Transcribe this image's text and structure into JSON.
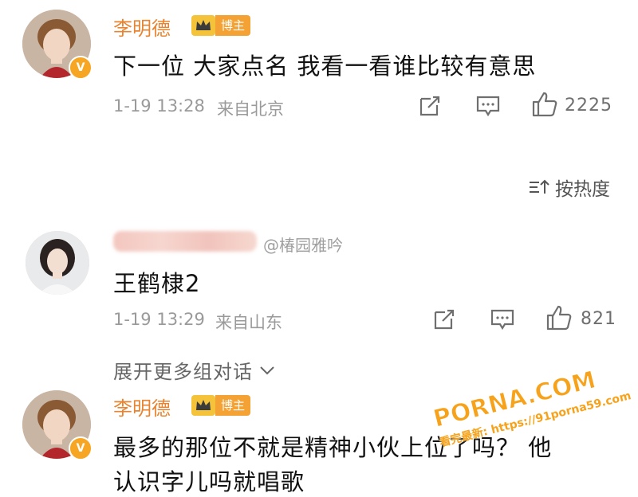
{
  "comments": [
    {
      "username": "李明德",
      "role_badge": "博主",
      "verified_mark": "V",
      "content": "下一位 大家点名 我看一看谁比较有意思",
      "time": "1-19 13:28",
      "location": "来自北京",
      "likes": "2225"
    },
    {
      "username": "",
      "content": "王鹤棣2",
      "time": "1-19 13:29",
      "location": "来自山东",
      "likes": "821"
    },
    {
      "username": "李明德",
      "role_badge": "博主",
      "verified_mark": "V",
      "content_line1": "最多的那位不就是精神小伙上位了吗？ 他",
      "content_line2": "认识字儿吗就唱歌"
    }
  ],
  "sort": {
    "label": "按热度"
  },
  "expand": {
    "label": "展开更多组对话"
  },
  "watermarks": {
    "weibo": "@椿园雅吟",
    "site": "PORNA.COM",
    "site_sub": "看完最新: https://91porna59.com"
  },
  "colors": {
    "username": "#e8832f",
    "badge": "#f4a233",
    "muted": "#9a9a9a"
  }
}
